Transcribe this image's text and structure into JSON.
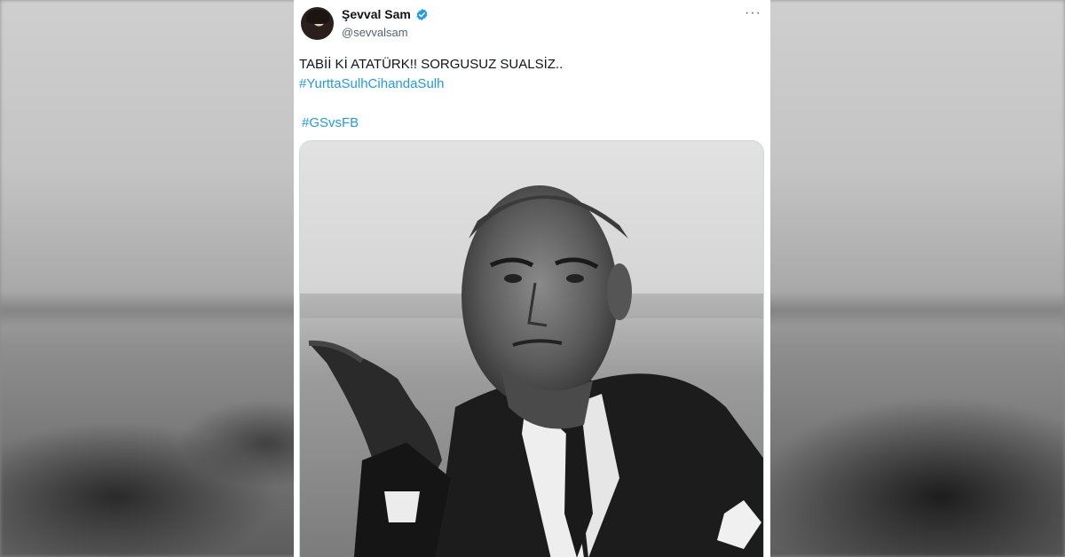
{
  "author": {
    "display_name": "Şevval Sam",
    "handle": "@sevvalsam",
    "verified": true,
    "verified_icon": "verified-badge-icon",
    "accent_color": "#1d9bf0"
  },
  "tweet": {
    "text_line": "TABİİ Kİ ATATÜRK!! SORGUSUZ SUALSİZ..",
    "hashtag_1": "#YurttaSulhCihandaSulh",
    "hashtag_2": "#GSvsFB"
  },
  "menu": {
    "more_label": "···",
    "icon": "more-options-icon"
  },
  "media": {
    "type": "black-and-white photograph",
    "icon": "photo"
  }
}
